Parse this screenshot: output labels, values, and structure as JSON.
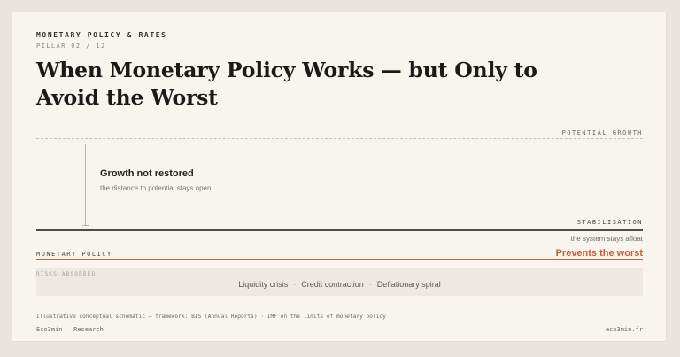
{
  "header": {
    "kicker": "MONETARY POLICY & RATES",
    "pillar": "PILLAR 02 / 12",
    "title": "When Monetary Policy Works — but Only to Avoid the Worst"
  },
  "diagram": {
    "potential_label": "POTENTIAL GROWTH",
    "gap_title": "Growth not restored",
    "gap_subtitle": "the distance to potential stays open",
    "stabilisation_label": "STABILISATION",
    "stabilisation_note": "the system stays afloat",
    "policy_label": "MONETARY POLICY",
    "policy_outcome": "Prevents the worst",
    "risks_label": "RISKS ABSORBED",
    "risks": [
      "Liquidity crisis",
      "Credit contraction",
      "Deflationary spiral"
    ],
    "risk_separator": "·"
  },
  "footer": {
    "source": "Illustrative conceptual schematic — framework: BIS (Annual Reports) · IMF on the limits of monetary policy",
    "brand": "Eco3min — Research",
    "site": "eco3min.fr"
  },
  "colors": {
    "accent": "#c0603c",
    "stabilisation_line": "#4a4d4e",
    "background": "#f8f5ee"
  }
}
